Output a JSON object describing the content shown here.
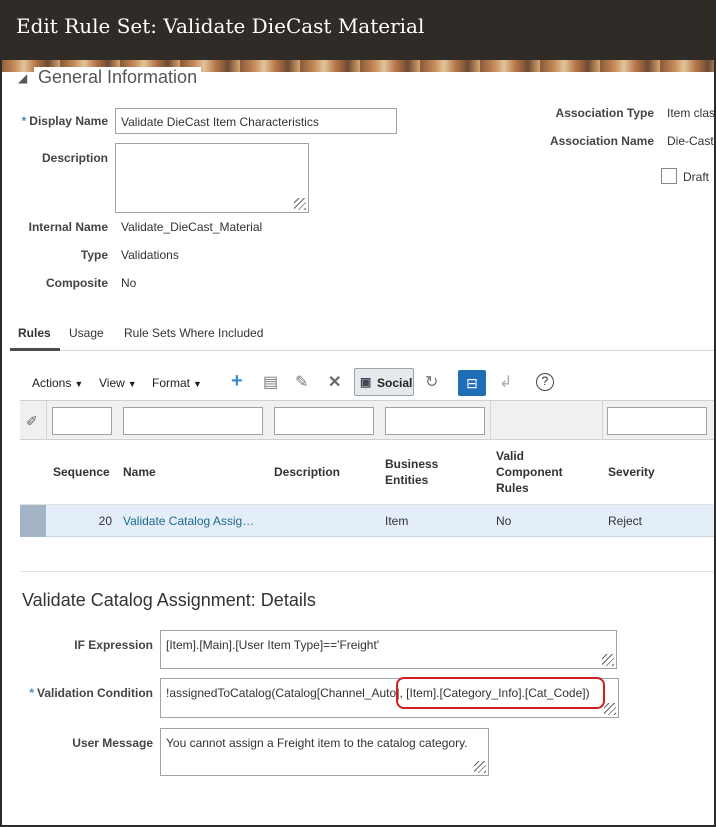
{
  "header": {
    "title": "Edit Rule Set: Validate DieCast Material"
  },
  "general": {
    "section_title": "General Information",
    "display_name_label": "Display Name",
    "display_name_value": "Validate DieCast Item Characteristics",
    "description_label": "Description",
    "description_value": "",
    "internal_name_label": "Internal Name",
    "internal_name_value": "Validate_DieCast_Material",
    "type_label": "Type",
    "type_value": "Validations",
    "composite_label": "Composite",
    "composite_value": "No",
    "association_type_label": "Association Type",
    "association_type_value": "Item clas",
    "association_name_label": "Association Name",
    "association_name_value": "Die-Cast",
    "draft_label": "Draft"
  },
  "tabs": [
    {
      "label": "Rules",
      "active": true
    },
    {
      "label": "Usage",
      "active": false
    },
    {
      "label": "Rule Sets Where Included",
      "active": false
    }
  ],
  "toolbar": {
    "actions_label": "Actions",
    "view_label": "View",
    "format_label": "Format",
    "social_label": "Social",
    "icons": [
      "add-icon",
      "detach-icon",
      "edit-icon",
      "delete-icon",
      "social-icon",
      "refresh-icon",
      "query-by-example-icon",
      "enter-icon",
      "help-icon"
    ]
  },
  "table": {
    "headers": {
      "sequence": "Sequence",
      "name": "Name",
      "description": "Description",
      "business_entities_1": "Business",
      "business_entities_2": "Entities",
      "valid_1": "Valid",
      "valid_2": "Component",
      "valid_3": "Rules",
      "severity": "Severity"
    },
    "rows": [
      {
        "sequence": "20",
        "name": "Validate Catalog Assig…",
        "description": "",
        "business_entities": "Item",
        "valid_component_rules": "No",
        "severity": "Reject"
      }
    ]
  },
  "details": {
    "title": "Validate Catalog Assignment: Details",
    "if_label": "IF Expression",
    "if_value": "[Item].[Main].[User Item Type]=='Freight'",
    "validation_label": "Validation Condition",
    "validation_value": "!assignedToCatalog(Catalog[Channel_Auto], [Item].[Category_Info].[Cat_Code])",
    "message_label": "User Message",
    "message_value": "You cannot assign a Freight item to the catalog category."
  },
  "colors": {
    "header_bg": "#2f2b27",
    "accent_blue": "#1f6fb6",
    "highlight_red": "#d11f1f",
    "selected_row": "#e4eef8"
  }
}
